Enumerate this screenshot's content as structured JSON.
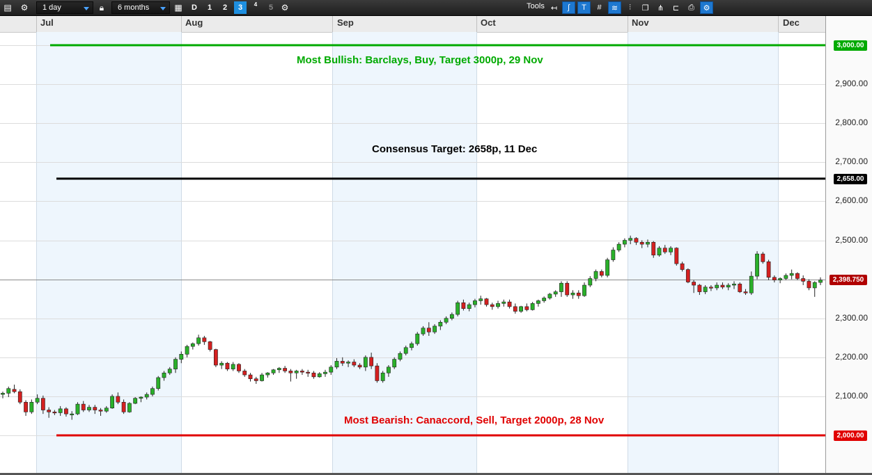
{
  "toolbar": {
    "interval": "1 day",
    "range": "6 months",
    "views": [
      "D",
      "1",
      "2",
      "3",
      "4",
      "5"
    ],
    "active_view": "3",
    "tools_label": "Tools"
  },
  "colors": {
    "bullish": "#00aa00",
    "consensus": "#000000",
    "bearish": "#e00000",
    "up": "#2ab02a",
    "down": "#d42020",
    "price_tag": "#b00000"
  },
  "chart_data": {
    "type": "candlestick",
    "x_axis": {
      "months": [
        "Jul",
        "Aug",
        "Sep",
        "Oct",
        "Nov",
        "Dec"
      ]
    },
    "y_axis": {
      "min": 1900,
      "max": 3040,
      "ticks": [
        2000,
        2100,
        2200,
        2300,
        2400,
        2500,
        2600,
        2700,
        2800,
        2900,
        3000
      ],
      "tick_labels": [
        "2,000.00",
        "2,100.00",
        "2,200.00",
        "2,300.00",
        "2,400.00",
        "2,500.00",
        "2,600.00",
        "2,700.00",
        "2,800.00",
        "2,900.00",
        "3,000.00"
      ]
    },
    "current_price": {
      "value": 2398.75,
      "label": "2,398.750"
    },
    "target_lines": [
      {
        "name": "bullish",
        "value": 3000,
        "tag": "3,000.00",
        "text": "Most Bullish: Barclays, Buy, Target 3000p, 29 Nov"
      },
      {
        "name": "consensus",
        "value": 2658,
        "tag": "2,658.00",
        "text": "Consensus Target: 2658p, 11 Dec"
      },
      {
        "name": "bearish",
        "value": 2000,
        "tag": "2,000.00",
        "text": "Most Bearish: Canaccord, Sell, Target 2000p, 28 Nov"
      }
    ],
    "candles": [
      [
        2105,
        2112,
        2095,
        2108
      ],
      [
        2108,
        2125,
        2098,
        2120
      ],
      [
        2118,
        2130,
        2108,
        2112
      ],
      [
        2112,
        2118,
        2080,
        2085
      ],
      [
        2085,
        2090,
        2050,
        2060
      ],
      [
        2060,
        2092,
        2055,
        2085
      ],
      [
        2085,
        2105,
        2080,
        2095
      ],
      [
        2095,
        2102,
        2055,
        2065
      ],
      [
        2065,
        2072,
        2045,
        2060
      ],
      [
        2060,
        2065,
        2052,
        2058
      ],
      [
        2058,
        2075,
        2050,
        2068
      ],
      [
        2068,
        2072,
        2048,
        2055
      ],
      [
        2055,
        2062,
        2040,
        2055
      ],
      [
        2055,
        2085,
        2052,
        2080
      ],
      [
        2080,
        2088,
        2060,
        2065
      ],
      [
        2065,
        2078,
        2060,
        2072
      ],
      [
        2072,
        2078,
        2055,
        2065
      ],
      [
        2065,
        2070,
        2050,
        2062
      ],
      [
        2062,
        2075,
        2058,
        2070
      ],
      [
        2070,
        2105,
        2068,
        2100
      ],
      [
        2100,
        2110,
        2080,
        2085
      ],
      [
        2085,
        2092,
        2055,
        2060
      ],
      [
        2060,
        2085,
        2058,
        2082
      ],
      [
        2082,
        2098,
        2080,
        2095
      ],
      [
        2095,
        2100,
        2085,
        2098
      ],
      [
        2098,
        2110,
        2092,
        2105
      ],
      [
        2105,
        2125,
        2100,
        2120
      ],
      [
        2120,
        2152,
        2115,
        2148
      ],
      [
        2148,
        2165,
        2140,
        2160
      ],
      [
        2160,
        2175,
        2155,
        2170
      ],
      [
        2170,
        2200,
        2160,
        2195
      ],
      [
        2195,
        2215,
        2185,
        2208
      ],
      [
        2208,
        2232,
        2200,
        2228
      ],
      [
        2228,
        2238,
        2220,
        2235
      ],
      [
        2235,
        2258,
        2230,
        2250
      ],
      [
        2250,
        2255,
        2232,
        2240
      ],
      [
        2240,
        2242,
        2215,
        2220
      ],
      [
        2220,
        2222,
        2175,
        2180
      ],
      [
        2180,
        2190,
        2170,
        2185
      ],
      [
        2185,
        2188,
        2165,
        2170
      ],
      [
        2170,
        2188,
        2165,
        2182
      ],
      [
        2182,
        2185,
        2160,
        2165
      ],
      [
        2165,
        2170,
        2150,
        2155
      ],
      [
        2155,
        2160,
        2138,
        2145
      ],
      [
        2145,
        2150,
        2132,
        2140
      ],
      [
        2140,
        2160,
        2138,
        2155
      ],
      [
        2155,
        2162,
        2148,
        2160
      ],
      [
        2160,
        2170,
        2155,
        2168
      ],
      [
        2168,
        2175,
        2160,
        2172
      ],
      [
        2172,
        2178,
        2160,
        2165
      ],
      [
        2165,
        2170,
        2138,
        2160
      ],
      [
        2160,
        2168,
        2145,
        2165
      ],
      [
        2165,
        2170,
        2155,
        2162
      ],
      [
        2162,
        2168,
        2150,
        2160
      ],
      [
        2160,
        2165,
        2145,
        2150
      ],
      [
        2150,
        2162,
        2148,
        2158
      ],
      [
        2158,
        2168,
        2150,
        2162
      ],
      [
        2162,
        2180,
        2155,
        2175
      ],
      [
        2175,
        2198,
        2170,
        2190
      ],
      [
        2190,
        2200,
        2178,
        2185
      ],
      [
        2185,
        2192,
        2175,
        2188
      ],
      [
        2188,
        2195,
        2175,
        2180
      ],
      [
        2180,
        2185,
        2170,
        2175
      ],
      [
        2175,
        2205,
        2165,
        2200
      ],
      [
        2200,
        2212,
        2170,
        2178
      ],
      [
        2178,
        2185,
        2135,
        2140
      ],
      [
        2140,
        2165,
        2135,
        2160
      ],
      [
        2160,
        2180,
        2150,
        2175
      ],
      [
        2175,
        2200,
        2170,
        2195
      ],
      [
        2195,
        2215,
        2190,
        2210
      ],
      [
        2210,
        2230,
        2205,
        2225
      ],
      [
        2225,
        2240,
        2218,
        2235
      ],
      [
        2235,
        2265,
        2230,
        2260
      ],
      [
        2260,
        2280,
        2255,
        2275
      ],
      [
        2275,
        2290,
        2255,
        2265
      ],
      [
        2265,
        2285,
        2260,
        2280
      ],
      [
        2280,
        2295,
        2270,
        2290
      ],
      [
        2290,
        2305,
        2285,
        2300
      ],
      [
        2300,
        2315,
        2295,
        2310
      ],
      [
        2310,
        2345,
        2305,
        2340
      ],
      [
        2340,
        2348,
        2320,
        2325
      ],
      [
        2325,
        2340,
        2318,
        2335
      ],
      [
        2335,
        2350,
        2328,
        2345
      ],
      [
        2345,
        2358,
        2335,
        2350
      ],
      [
        2350,
        2352,
        2330,
        2335
      ],
      [
        2335,
        2340,
        2322,
        2330
      ],
      [
        2330,
        2345,
        2325,
        2338
      ],
      [
        2338,
        2348,
        2330,
        2342
      ],
      [
        2342,
        2348,
        2325,
        2330
      ],
      [
        2330,
        2338,
        2312,
        2318
      ],
      [
        2318,
        2332,
        2314,
        2330
      ],
      [
        2330,
        2338,
        2318,
        2322
      ],
      [
        2322,
        2342,
        2320,
        2338
      ],
      [
        2338,
        2348,
        2330,
        2345
      ],
      [
        2345,
        2356,
        2340,
        2352
      ],
      [
        2352,
        2365,
        2348,
        2362
      ],
      [
        2362,
        2372,
        2355,
        2368
      ],
      [
        2368,
        2395,
        2355,
        2390
      ],
      [
        2390,
        2395,
        2355,
        2360
      ],
      [
        2360,
        2372,
        2350,
        2365
      ],
      [
        2365,
        2372,
        2350,
        2358
      ],
      [
        2358,
        2392,
        2355,
        2385
      ],
      [
        2385,
        2408,
        2380,
        2402
      ],
      [
        2402,
        2425,
        2395,
        2420
      ],
      [
        2420,
        2425,
        2405,
        2410
      ],
      [
        2410,
        2455,
        2405,
        2450
      ],
      [
        2450,
        2482,
        2445,
        2475
      ],
      [
        2475,
        2495,
        2470,
        2490
      ],
      [
        2490,
        2505,
        2482,
        2500
      ],
      [
        2500,
        2512,
        2490,
        2505
      ],
      [
        2505,
        2508,
        2488,
        2495
      ],
      [
        2495,
        2500,
        2480,
        2490
      ],
      [
        2490,
        2502,
        2482,
        2495
      ],
      [
        2495,
        2498,
        2455,
        2462
      ],
      [
        2462,
        2485,
        2458,
        2480
      ],
      [
        2480,
        2488,
        2465,
        2470
      ],
      [
        2470,
        2485,
        2462,
        2480
      ],
      [
        2480,
        2482,
        2435,
        2440
      ],
      [
        2440,
        2445,
        2420,
        2425
      ],
      [
        2425,
        2428,
        2390,
        2393
      ],
      [
        2393,
        2398,
        2365,
        2385
      ],
      [
        2385,
        2388,
        2360,
        2368
      ],
      [
        2368,
        2385,
        2362,
        2380
      ],
      [
        2380,
        2385,
        2370,
        2378
      ],
      [
        2378,
        2392,
        2372,
        2385
      ],
      [
        2385,
        2392,
        2375,
        2380
      ],
      [
        2380,
        2390,
        2372,
        2385
      ],
      [
        2385,
        2395,
        2375,
        2388
      ],
      [
        2388,
        2392,
        2365,
        2368
      ],
      [
        2368,
        2375,
        2360,
        2365
      ],
      [
        2365,
        2420,
        2360,
        2408
      ],
      [
        2408,
        2472,
        2400,
        2465
      ],
      [
        2465,
        2470,
        2440,
        2445
      ],
      [
        2445,
        2450,
        2398,
        2405
      ],
      [
        2405,
        2410,
        2392,
        2398
      ],
      [
        2398,
        2405,
        2390,
        2402
      ],
      [
        2402,
        2415,
        2398,
        2410
      ],
      [
        2410,
        2425,
        2400,
        2415
      ],
      [
        2415,
        2418,
        2398,
        2402
      ],
      [
        2402,
        2410,
        2385,
        2395
      ],
      [
        2395,
        2400,
        2372,
        2378
      ],
      [
        2378,
        2395,
        2355,
        2392
      ],
      [
        2392,
        2405,
        2385,
        2398
      ]
    ]
  }
}
